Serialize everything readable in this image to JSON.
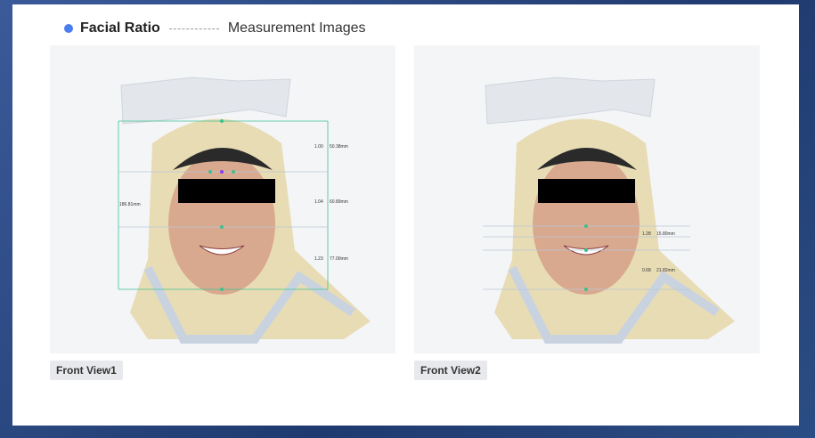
{
  "header": {
    "title": "Facial Ratio",
    "subtitle": "Measurement Images"
  },
  "views": [
    {
      "label": "Front View1",
      "measurements": [
        {
          "ratio": "1.00",
          "value": "50.38mm"
        },
        {
          "ratio": "1.04",
          "value": "60.89mm"
        },
        {
          "ratio": "1.23",
          "value": "77.00mm"
        }
      ],
      "total": "186.81mm"
    },
    {
      "label": "Front View2",
      "measurements": [
        {
          "ratio": "1.28",
          "value": "15.80mm"
        },
        {
          "ratio": "0.68",
          "value": "21.82mm"
        }
      ]
    }
  ],
  "colors": {
    "accent": "#4a7ef0",
    "guide_line": "#3fbf8f",
    "redaction": "#000000"
  }
}
